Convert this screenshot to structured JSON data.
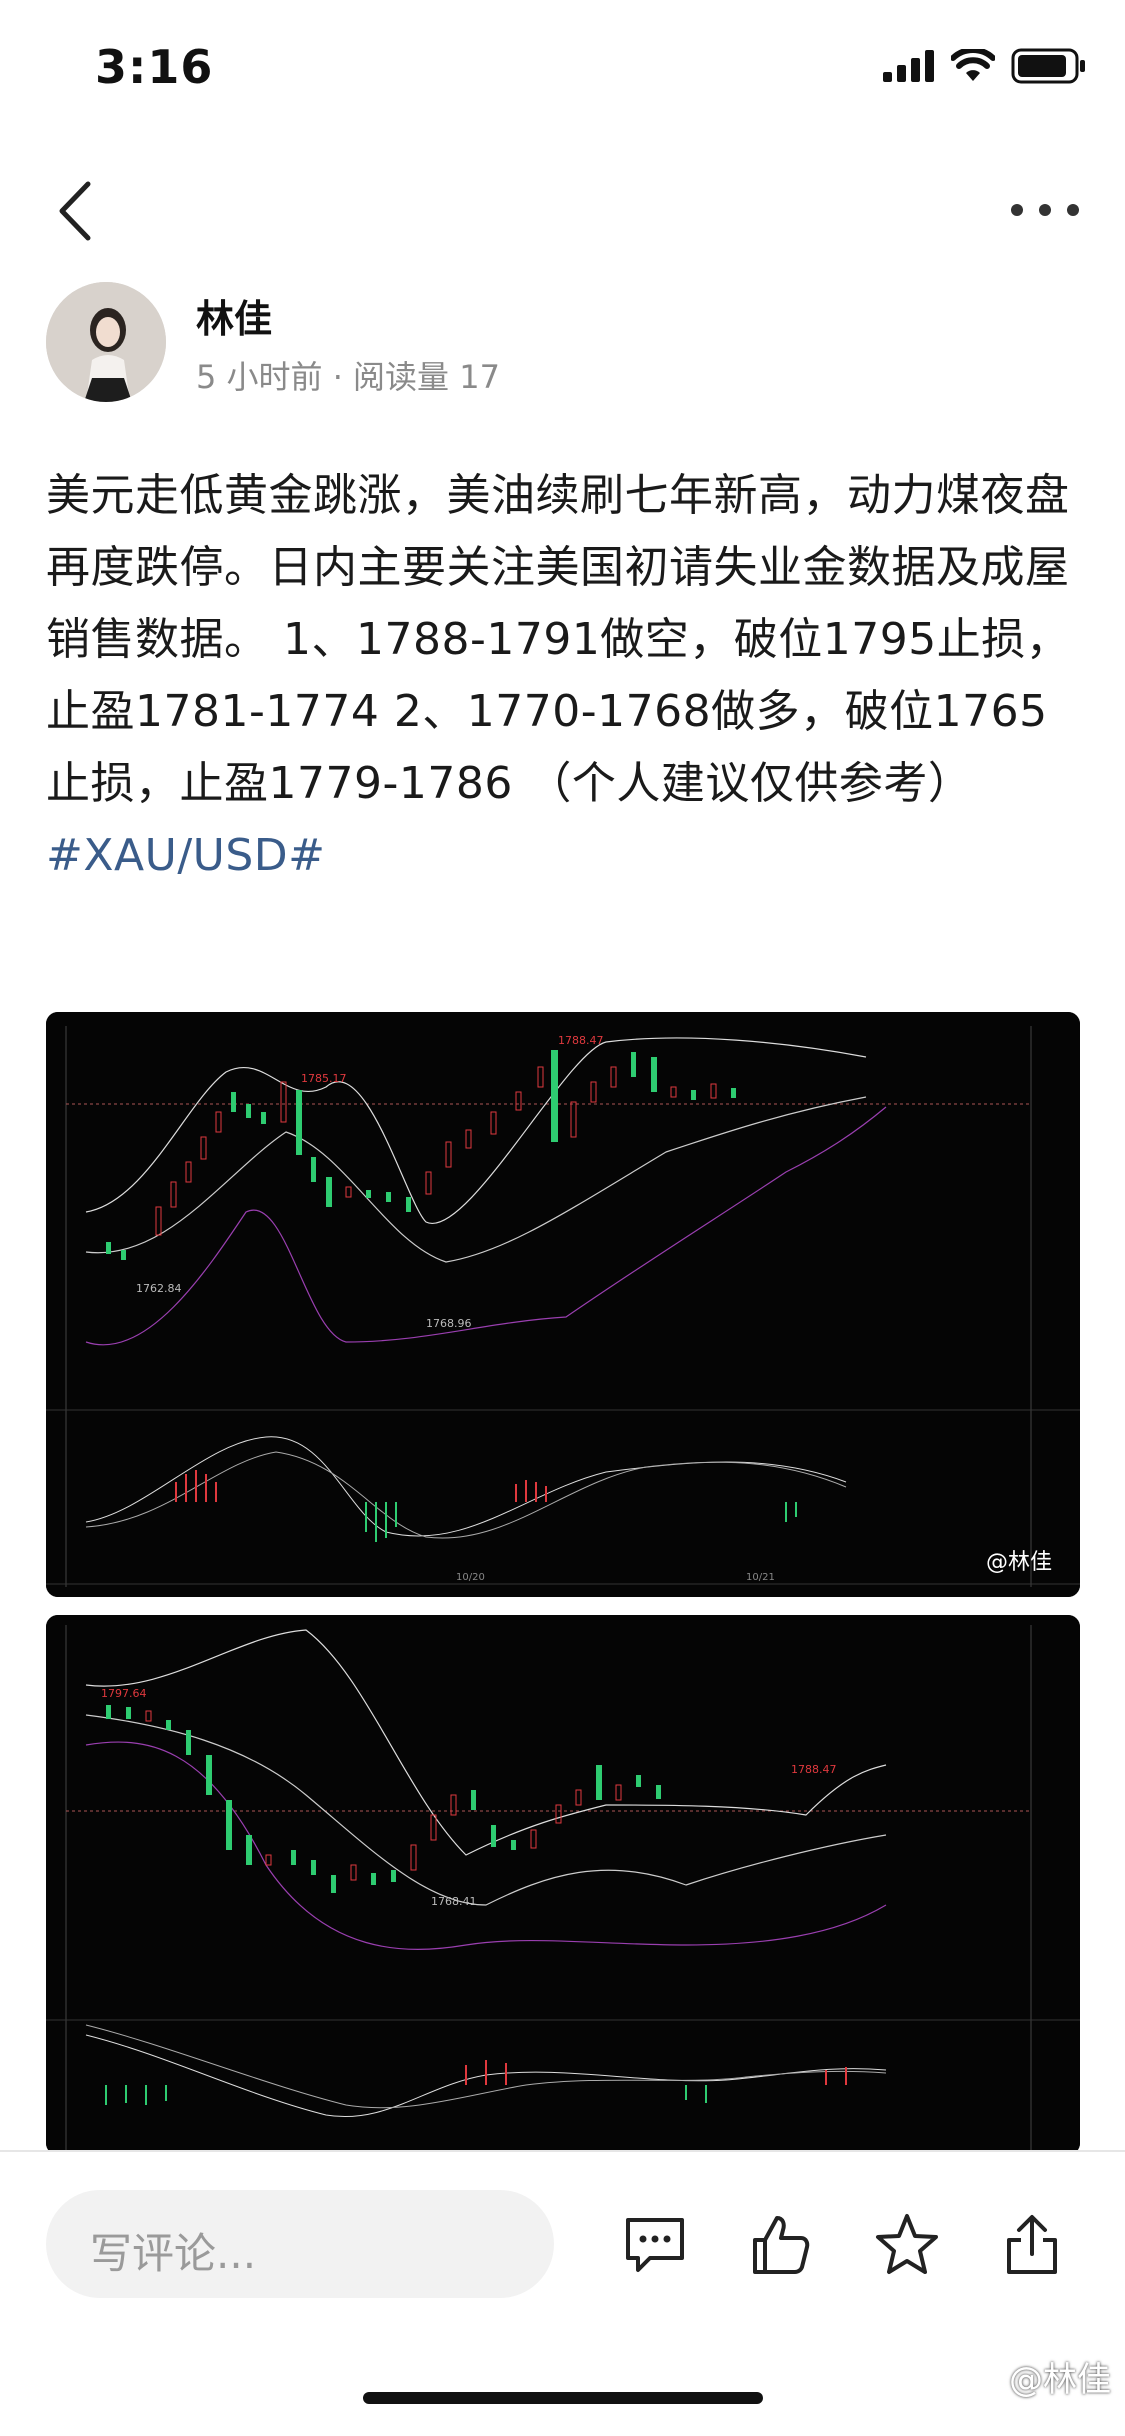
{
  "status": {
    "time": "3:16"
  },
  "author": {
    "name": "林佳",
    "meta": "5 小时前 · 阅读量 17"
  },
  "post": {
    "text": "美元走低黄金跳涨，美油续刷七年新高，动力煤夜盘再度跌停。日内主要关注美国初请失业金数据及成屋销售数据。 1、1788-1791做空，破位1795止损，止盈1781-1774 2、1770-1768做多，破位1765止损，止盈1779-1786 （个人建议仅供参考）",
    "hashtag": "#XAU/USD#"
  },
  "charts": {
    "chart1_watermark": "@林佳",
    "chart1_high_label": "1788.47",
    "chart1_peak_label": "1785.17",
    "chart1_low_label": "1762.84",
    "chart1_low2_label": "1768.96",
    "chart2_high_label": "1788.47",
    "chart2_low_label": "1768.41",
    "chart2_start_label": "1797.64",
    "chart1_date_label": "10/20",
    "chart1_date2_label": "10/21"
  },
  "bottom_bar": {
    "comment_placeholder": "写评论..."
  },
  "watermark": "@林佳",
  "colors": {
    "tag": "#3a5c8a",
    "up": "#e0393e",
    "down": "#2ecc71",
    "bg": "#000000"
  }
}
